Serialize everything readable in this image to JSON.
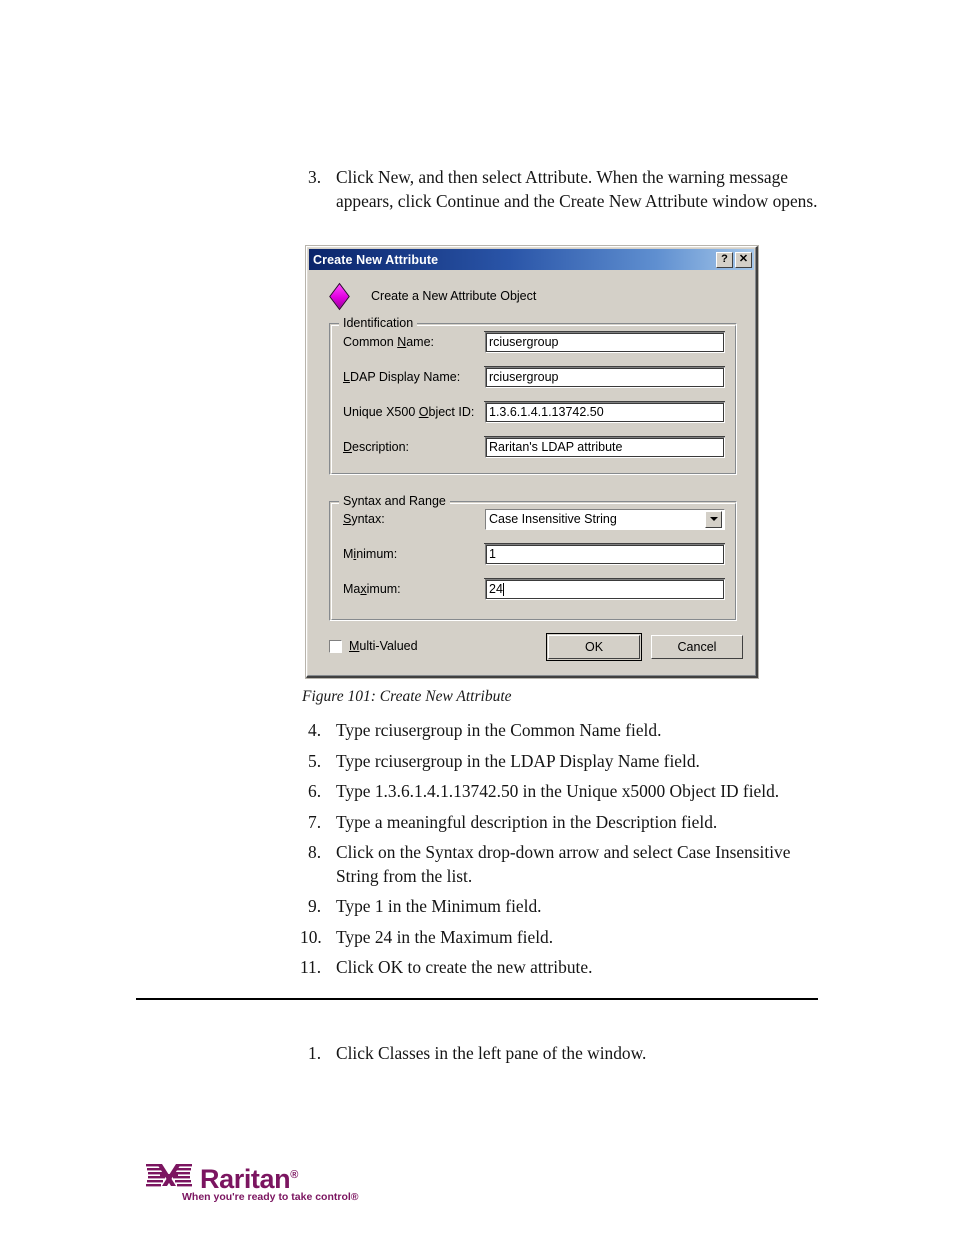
{
  "document": {
    "intro_item": {
      "number": "3.",
      "text": "Click New, and then select Attribute. When the warning message appears, click Continue and the Create New Attribute window opens."
    },
    "figure_caption": "Figure 101: Create New Attribute",
    "steps": [
      {
        "number": "4.",
        "text": "Type rciusergroup in the Common Name field."
      },
      {
        "number": "5.",
        "text": "Type rciusergroup in the LDAP Display Name field."
      },
      {
        "number": "6.",
        "text": "Type 1.3.6.1.4.1.13742.50 in the Unique x5000 Object ID field."
      },
      {
        "number": "7.",
        "text": "Type a meaningful description in the Description field."
      },
      {
        "number": "8.",
        "text": "Click on the Syntax drop-down arrow and select Case Insensitive String from the list."
      },
      {
        "number": "9.",
        "text": "Type 1 in the Minimum field."
      },
      {
        "number": "10.",
        "text": "Type 24 in the Maximum field."
      },
      {
        "number": "11.",
        "text": "Click OK to create the new attribute."
      }
    ],
    "bottom_steps": [
      {
        "number": "1.",
        "text": "Click Classes in the left pane of the window."
      }
    ]
  },
  "dialog": {
    "title": "Create New Attribute",
    "titlebar_buttons": [
      {
        "name": "help-button",
        "glyph": "?"
      },
      {
        "name": "close-button",
        "glyph": "✕"
      }
    ],
    "header_text": "Create a New Attribute Object",
    "header_icon": "attribute-object-icon",
    "groups": [
      {
        "legend": "Identification",
        "fields": [
          {
            "label_pre": "Common ",
            "label_key": "N",
            "label_post": "ame:",
            "value": "rciusergroup",
            "name": "common-name"
          },
          {
            "label_pre": "",
            "label_key": "L",
            "label_post": "DAP Display Name:",
            "value": "rciusergroup",
            "name": "ldap-display-name"
          },
          {
            "label_pre": "Unique X500 ",
            "label_key": "O",
            "label_post": "bject ID:",
            "value": "1.3.6.1.4.1.13742.50",
            "name": "unique-x500-object-id"
          },
          {
            "label_pre": "",
            "label_key": "D",
            "label_post": "escription:",
            "value": "Raritan's LDAP attribute",
            "name": "description"
          }
        ]
      },
      {
        "legend": "Syntax and Range",
        "fields": [
          {
            "label_pre": "",
            "label_key": "S",
            "label_post": "yntax:",
            "value": "Case Insensitive String",
            "name": "syntax",
            "type": "combobox"
          },
          {
            "label_pre": "M",
            "label_key": "i",
            "label_post": "nimum:",
            "value": "1",
            "name": "minimum"
          },
          {
            "label_pre": "Ma",
            "label_key": "x",
            "label_post": "imum:",
            "value": "24",
            "name": "maximum",
            "caret": true
          }
        ]
      }
    ],
    "checkbox": {
      "label_pre": "",
      "label_key": "M",
      "label_post": "ulti-Valued",
      "checked": false,
      "name": "multi-valued"
    },
    "buttons": [
      {
        "label": "OK",
        "name": "ok-button",
        "default": true
      },
      {
        "label": "Cancel",
        "name": "cancel-button",
        "default": false
      }
    ],
    "colors": {
      "face": "#d4d0c8",
      "titlebar_start": "#0a246a",
      "titlebar_end": "#a6c8ea",
      "icon_magenta": "#e000e0"
    }
  },
  "footer": {
    "logo_word": "Raritan",
    "logo_registered": "®",
    "logo_tagline": "When you're ready to take control®",
    "logo_color": "#7b1560"
  }
}
